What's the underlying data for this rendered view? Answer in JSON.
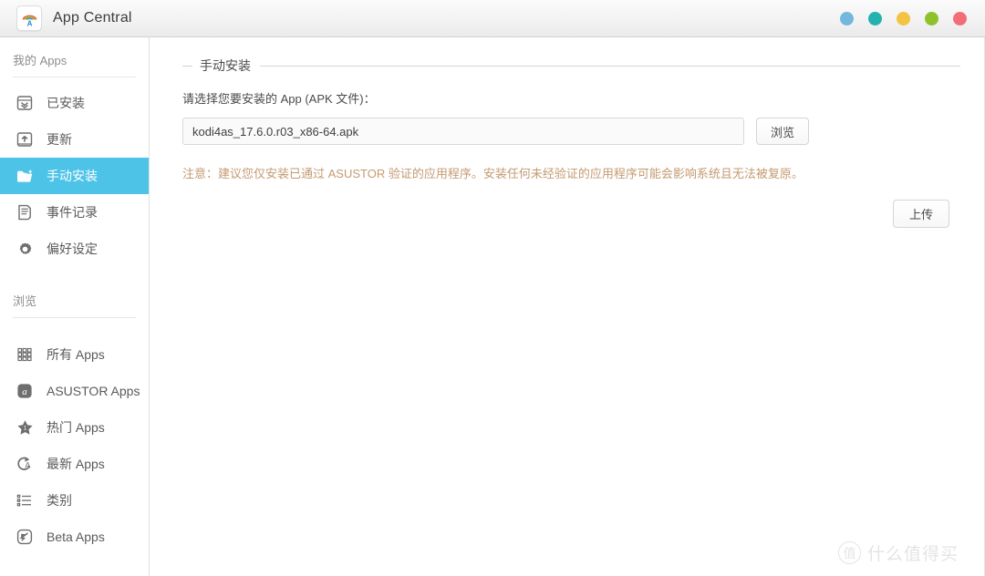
{
  "window": {
    "title": "App Central",
    "logo_icon": "app-central-rainbow-icon",
    "controls": [
      {
        "name": "minimize-dot",
        "icon": "circle-icon",
        "color": "#72b8dd"
      },
      {
        "name": "fullscreen-dot",
        "icon": "circle-icon",
        "color": "#23b2ae"
      },
      {
        "name": "restore-dot",
        "icon": "circle-icon",
        "color": "#f5c342"
      },
      {
        "name": "maximize-dot",
        "icon": "circle-icon",
        "color": "#8dc22b"
      },
      {
        "name": "close-dot",
        "icon": "circle-icon",
        "color": "#f26d75"
      }
    ]
  },
  "sidebar": {
    "sections": [
      {
        "header": "我的 Apps",
        "items": [
          {
            "label": "已安装",
            "icon": "installed-box-icon",
            "active": false
          },
          {
            "label": "更新",
            "icon": "update-upload-icon",
            "active": false
          },
          {
            "label": "手动安装",
            "icon": "folder-plus-icon",
            "active": true
          },
          {
            "label": "事件记录",
            "icon": "log-document-icon",
            "active": false
          },
          {
            "label": "偏好设定",
            "icon": "gear-icon",
            "active": false
          }
        ]
      },
      {
        "header": "浏览",
        "items": [
          {
            "label": "所有 Apps",
            "icon": "grid-apps-icon",
            "active": false
          },
          {
            "label": "ASUSTOR Apps",
            "icon": "asustor-a-icon",
            "active": false
          },
          {
            "label": "热门 Apps",
            "icon": "star-hot-icon",
            "active": false
          },
          {
            "label": "最新 Apps",
            "icon": "refresh-a-icon",
            "active": false
          },
          {
            "label": "类别",
            "icon": "list-category-icon",
            "active": false
          },
          {
            "label": "Beta Apps",
            "icon": "beta-arrow-icon",
            "active": false
          }
        ]
      }
    ]
  },
  "main": {
    "legend": "手动安装",
    "form_label": "请选择您要安装的 App (APK 文件)：",
    "file_value": "kodi4as_17.6.0.r03_x86-64.apk",
    "file_placeholder": "",
    "browse_button": "浏览",
    "warning": "注意：建议您仅安装已通过 ASUSTOR 验证的应用程序。安装任何未经验证的应用程序可能会影响系统且无法被复原。",
    "upload_button": "上传",
    "warning_color": "#c49a72",
    "accent_color": "#4ec3e8"
  },
  "watermark": {
    "mark": "值",
    "text": "什么值得买"
  }
}
